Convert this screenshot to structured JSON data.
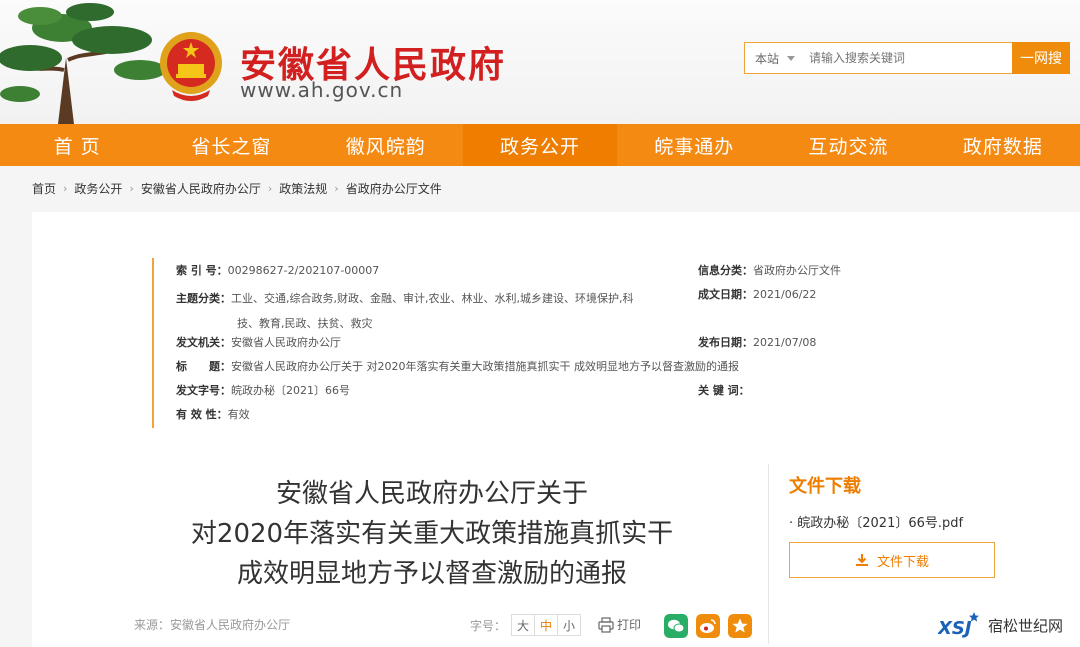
{
  "header": {
    "site_title": "安徽省人民政府",
    "site_url": "www.ah.gov.cn",
    "search_scope": "本站",
    "search_placeholder": "请输入搜索关键词",
    "search_button": "一网搜"
  },
  "nav": {
    "items": [
      "首 页",
      "省长之窗",
      "徽风皖韵",
      "政务公开",
      "皖事通办",
      "互动交流",
      "政府数据"
    ],
    "active_index": 3
  },
  "breadcrumb": [
    "首页",
    "政务公开",
    "安徽省人民政府办公厅",
    "政策法规",
    "省政府办公厅文件"
  ],
  "meta": {
    "index_label": "索 引 号：",
    "index_value": "00298627-2/202107-00007",
    "info_cat_label": "信息分类：",
    "info_cat_value": "省政府办公厅文件",
    "topic_label": "主题分类：",
    "topic_value_line1": "工业、交通,综合政务,财政、金融、审计,农业、林业、水利,城乡建设、环境保护,科",
    "topic_value_line2": "技、教育,民政、扶贫、救灾",
    "made_date_label": "成文日期：",
    "made_date_value": "2021/06/22",
    "issuer_label": "发文机关：",
    "issuer_value": "安徽省人民政府办公厅",
    "pub_date_label": "发布日期：",
    "pub_date_value": "2021/07/08",
    "title_label": "标　　题：",
    "title_value": "安徽省人民政府办公厅关于 对2020年落实有关重大政策措施真抓实干 成效明显地方予以督查激励的通报",
    "doc_no_label": "发文字号：",
    "doc_no_value": "皖政办秘〔2021〕66号",
    "keywords_label": "关 键 词：",
    "keywords_value": "",
    "validity_label": "有 效 性：",
    "validity_value": "有效"
  },
  "article": {
    "title_line1": "安徽省人民政府办公厅关于",
    "title_line2": "对2020年落实有关重大政策措施真抓实干",
    "title_line3": "成效明显地方予以督查激励的通报",
    "source": "来源：安徽省人民政府办公厅",
    "fontsize_label": "字号：",
    "fs_large": "大",
    "fs_medium": "中",
    "fs_small": "小",
    "print_label": "打印"
  },
  "download": {
    "title": "文件下载",
    "file_name": "皖政办秘〔2021〕66号.pdf",
    "button_label": "文件下载"
  },
  "watermark": {
    "logo_text": "XSJ",
    "text": "宿松世纪网"
  },
  "colors": {
    "nav_bg": "#f58a12",
    "nav_active": "#ee7d00",
    "title_red": "#d21f1f",
    "accent_orange": "#ee7d00",
    "wechat_green": "#2aae67",
    "weibo_orange": "#f08c0c"
  },
  "icons": [
    "pine-tree-icon",
    "national-emblem-icon",
    "chevron-down-icon",
    "download-icon",
    "printer-icon",
    "wechat-icon",
    "weibo-icon",
    "favorite-star-icon"
  ]
}
